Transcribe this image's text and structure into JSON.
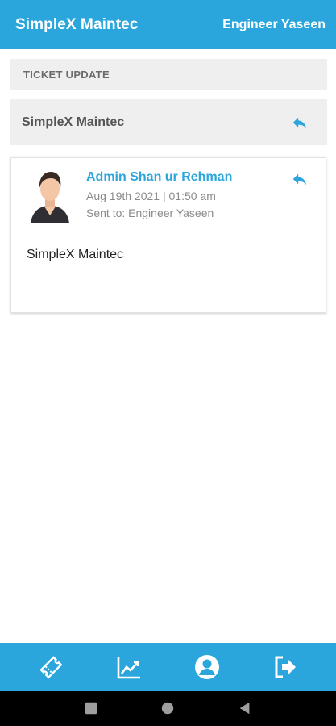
{
  "app_bar": {
    "title": "SimpleX Maintec",
    "user_name": "Engineer Yaseen"
  },
  "ticket": {
    "section_header": "TICKET UPDATE",
    "subject": "SimpleX Maintec",
    "reply_icon": "reply-icon"
  },
  "message": {
    "sender": "Admin Shan ur Rehman",
    "timestamp": "Aug 19th 2021 | 01:50 am",
    "sent_to": "Sent to: Engineer Yaseen",
    "body": "SimpleX Maintec",
    "avatar_icon": "user-avatar"
  },
  "bottom_nav": {
    "items": [
      {
        "icon": "ticket-icon"
      },
      {
        "icon": "chart-icon"
      },
      {
        "icon": "profile-icon"
      },
      {
        "icon": "logout-icon"
      }
    ]
  },
  "system_nav": {
    "items": [
      {
        "icon": "recents-icon"
      },
      {
        "icon": "home-icon"
      },
      {
        "icon": "back-icon"
      }
    ]
  },
  "colors": {
    "primary": "#2aa6dc",
    "panel_bg": "#efefef",
    "muted_text": "#8a8a8a"
  }
}
